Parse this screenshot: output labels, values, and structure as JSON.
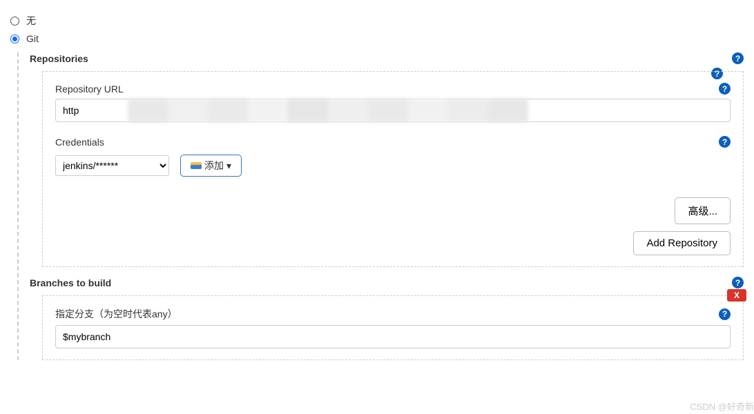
{
  "scm": {
    "none_label": "无",
    "git_label": "Git",
    "selected": "git"
  },
  "repositories": {
    "title": "Repositories",
    "url_label": "Repository URL",
    "url_value": "http",
    "cred_label": "Credentials",
    "cred_selected": "jenkins/******",
    "add_label": "添加",
    "advanced_label": "高级...",
    "add_repo_label": "Add Repository"
  },
  "branches": {
    "title": "Branches to build",
    "specifier_label": "指定分支（为空时代表any）",
    "specifier_value": "$mybranch",
    "delete_label": "X"
  },
  "watermark": "CSDN @好奇新"
}
